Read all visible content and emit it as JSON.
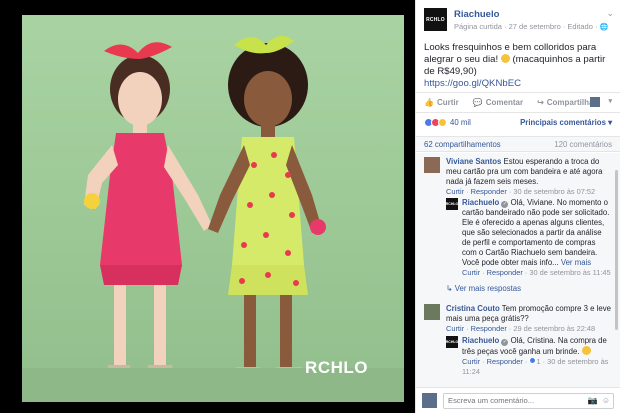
{
  "page": {
    "name": "Riachuelo",
    "logo_text": "RCHLO",
    "meta_type": "Página curtida",
    "meta_date": "27 de setembro",
    "meta_edited": "Editado",
    "globe": "🌐"
  },
  "post": {
    "text": "Looks fresquinhos e bem colloridos para alegrar o seu dia!",
    "text_suffix": "(macaquinhos a partir de R$49,90)",
    "link": "https://goo.gl/QKNbEC"
  },
  "photo": {
    "watermark": "RCHLO"
  },
  "actions": {
    "like_label": "Curtir",
    "comment_label": "Comentar",
    "share_label": "Compartilhar"
  },
  "reactions": {
    "count": "40 mil",
    "sort_label": "Principais comentários ▾"
  },
  "counts": {
    "shares": "62 compartilhamentos",
    "comments": "120 comentários"
  },
  "comments": [
    {
      "author": "Viviane Santos",
      "text": "Estou esperando a troca do meu cartão pra um com bandeira e até agora nada já fazem seis meses.",
      "like": "Curtir",
      "reply": "Responder",
      "time": "30 de setembro às 07:52"
    },
    {
      "author": "Riachuelo",
      "text": "Olá, Viviane. No momento o cartão bandeirado não pode ser solicitado. Ele é oferecido a apenas alguns clientes, que são selecionados a partir da análise de perfil e comportamento de compras com o Cartão Riachuelo sem bandeira. Você pode obter mais info...",
      "see_more": "Ver mais",
      "like": "Curtir",
      "reply": "Responder",
      "time": "30 de setembro às 11:45"
    },
    {
      "more_replies": "Ver mais respostas"
    },
    {
      "author": "Cristina Couto",
      "text": "Tem promoção compre 3 e leve mais uma peça grátis??",
      "like": "Curtir",
      "reply": "Responder",
      "time": "29 de setembro às 22:48"
    },
    {
      "author": "Riachuelo",
      "text": "Olá, Cristina. Na compra de três peças você ganha um brinde.",
      "like": "Curtir",
      "reply": "Responder",
      "likes_count": "1",
      "time": "30 de setembro às 11:24"
    }
  ],
  "write": {
    "placeholder": "Escreva um comentário..."
  }
}
